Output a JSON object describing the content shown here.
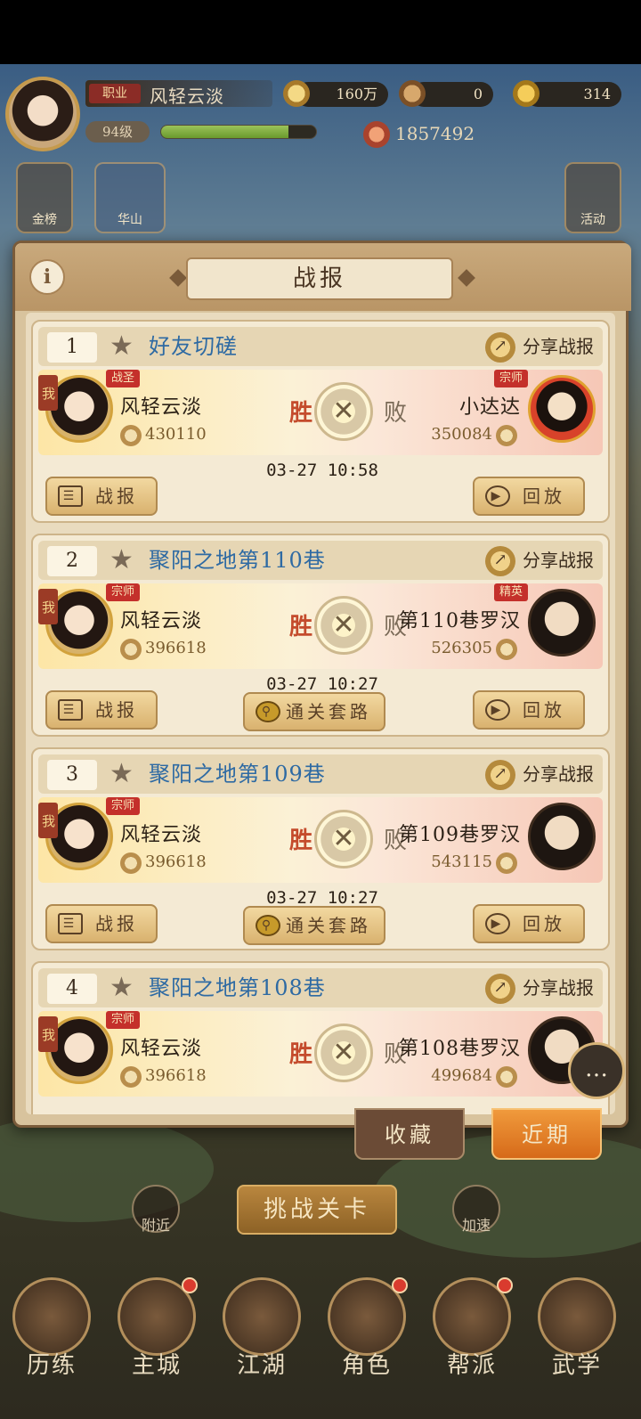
{
  "player": {
    "title_badge": "职业",
    "name": "风轻云淡",
    "level": "94级",
    "exp_fraction": 0.82,
    "coins": "160万",
    "ingots": "0",
    "gold": "314",
    "power": "1857492"
  },
  "top_icons": [
    {
      "label": "金榜",
      "icon": "gold-list-icon"
    },
    {
      "label": "华山",
      "icon": "mountain-icon"
    },
    {
      "label": "活动",
      "icon": "event-icon"
    }
  ],
  "dialog": {
    "title": "战报",
    "info": "i",
    "share_label": "分享战报",
    "report_label": "战报",
    "replay_label": "回放",
    "strategy_label": "通关套路",
    "me_tag": "我",
    "win_label": "胜",
    "lose_label": "败"
  },
  "records": [
    {
      "index": "1",
      "title": "好友切磋",
      "left_badge": "战圣",
      "left_name": "风轻云淡",
      "left_power": "430110",
      "right_badge": "宗师",
      "right_name": "小达达",
      "right_power": "350084",
      "time": "03-27 10:58",
      "has_strategy": false,
      "enemy": "xiaoda"
    },
    {
      "index": "2",
      "title": "聚阳之地第110巷",
      "left_badge": "宗师",
      "left_name": "风轻云淡",
      "left_power": "396618",
      "right_badge": "精英",
      "right_name": "第110巷罗汉",
      "right_power": "526305",
      "time": "03-27 10:27",
      "has_strategy": true,
      "enemy": "monk"
    },
    {
      "index": "3",
      "title": "聚阳之地第109巷",
      "left_badge": "宗师",
      "left_name": "风轻云淡",
      "left_power": "396618",
      "right_badge": "",
      "right_name": "第109巷罗汉",
      "right_power": "543115",
      "time": "03-27 10:27",
      "has_strategy": true,
      "enemy": "monk"
    },
    {
      "index": "4",
      "title": "聚阳之地第108巷",
      "left_badge": "宗师",
      "left_name": "风轻云淡",
      "left_power": "396618",
      "right_badge": "",
      "right_name": "第108巷罗汉",
      "right_power": "499684",
      "time": "",
      "has_strategy": false,
      "enemy": "monk"
    }
  ],
  "tabs": {
    "favorites": "收藏",
    "recent": "近期"
  },
  "actions": {
    "challenge": "挑战关卡",
    "nearby": "附近",
    "speed": "加速",
    "chat": "…"
  },
  "nav": [
    {
      "label": "历练",
      "icon": "training-icon",
      "dot": false
    },
    {
      "label": "主城",
      "icon": "city-icon",
      "dot": true
    },
    {
      "label": "江湖",
      "icon": "jianghu-icon",
      "dot": false
    },
    {
      "label": "角色",
      "icon": "character-icon",
      "dot": true
    },
    {
      "label": "帮派",
      "icon": "guild-icon",
      "dot": true
    },
    {
      "label": "武学",
      "icon": "martial-arts-icon",
      "dot": false
    }
  ]
}
